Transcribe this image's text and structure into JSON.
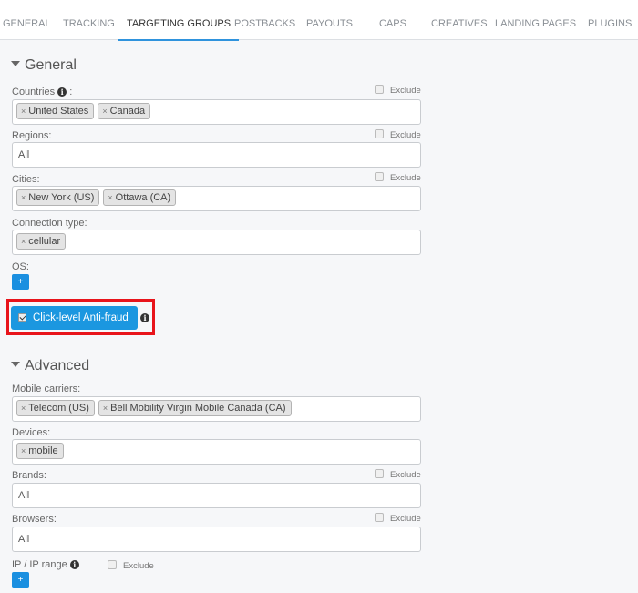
{
  "tabs": [
    {
      "label": "GENERAL",
      "active": false
    },
    {
      "label": "TRACKING",
      "active": false
    },
    {
      "label": "TARGETING GROUPS",
      "active": true
    },
    {
      "label": "POSTBACKS",
      "active": false
    },
    {
      "label": "PAYOUTS",
      "active": false
    },
    {
      "label": "CAPS",
      "active": false
    },
    {
      "label": "CREATIVES",
      "active": false
    },
    {
      "label": "LANDING PAGES",
      "active": false
    },
    {
      "label": "PLUGINS",
      "active": false
    }
  ],
  "general": {
    "title": "General",
    "countries": {
      "label": "Countries",
      "label_suffix": ":",
      "exclude": "Exclude",
      "values": [
        "United States",
        "Canada"
      ]
    },
    "regions": {
      "label": "Regions:",
      "exclude": "Exclude",
      "value": "All"
    },
    "cities": {
      "label": "Cities:",
      "exclude": "Exclude",
      "values": [
        "New York (US)",
        "Ottawa (CA)"
      ]
    },
    "connection_type": {
      "label": "Connection type:",
      "values": [
        "cellular"
      ]
    },
    "os": {
      "label": "OS:",
      "add": "+"
    },
    "anti_fraud": {
      "label": "Click-level Anti-fraud",
      "checked": true
    }
  },
  "advanced": {
    "title": "Advanced",
    "mobile_carriers": {
      "label": "Mobile carriers:",
      "values": [
        "Telecom (US)",
        "Bell Mobility Virgin Mobile Canada (CA)"
      ]
    },
    "devices": {
      "label": "Devices:",
      "values": [
        "mobile"
      ]
    },
    "brands": {
      "label": "Brands:",
      "exclude": "Exclude",
      "value": "All"
    },
    "browsers": {
      "label": "Browsers:",
      "exclude": "Exclude",
      "value": "All"
    },
    "ip_range": {
      "label": "IP / IP range",
      "exclude": "Exclude",
      "add": "+"
    }
  },
  "icons": {
    "info": "i",
    "chip_remove": "×"
  },
  "colors": {
    "accent": "#1b97e0",
    "highlight": "#e8141b",
    "tab_underline": "#2f93dd"
  }
}
